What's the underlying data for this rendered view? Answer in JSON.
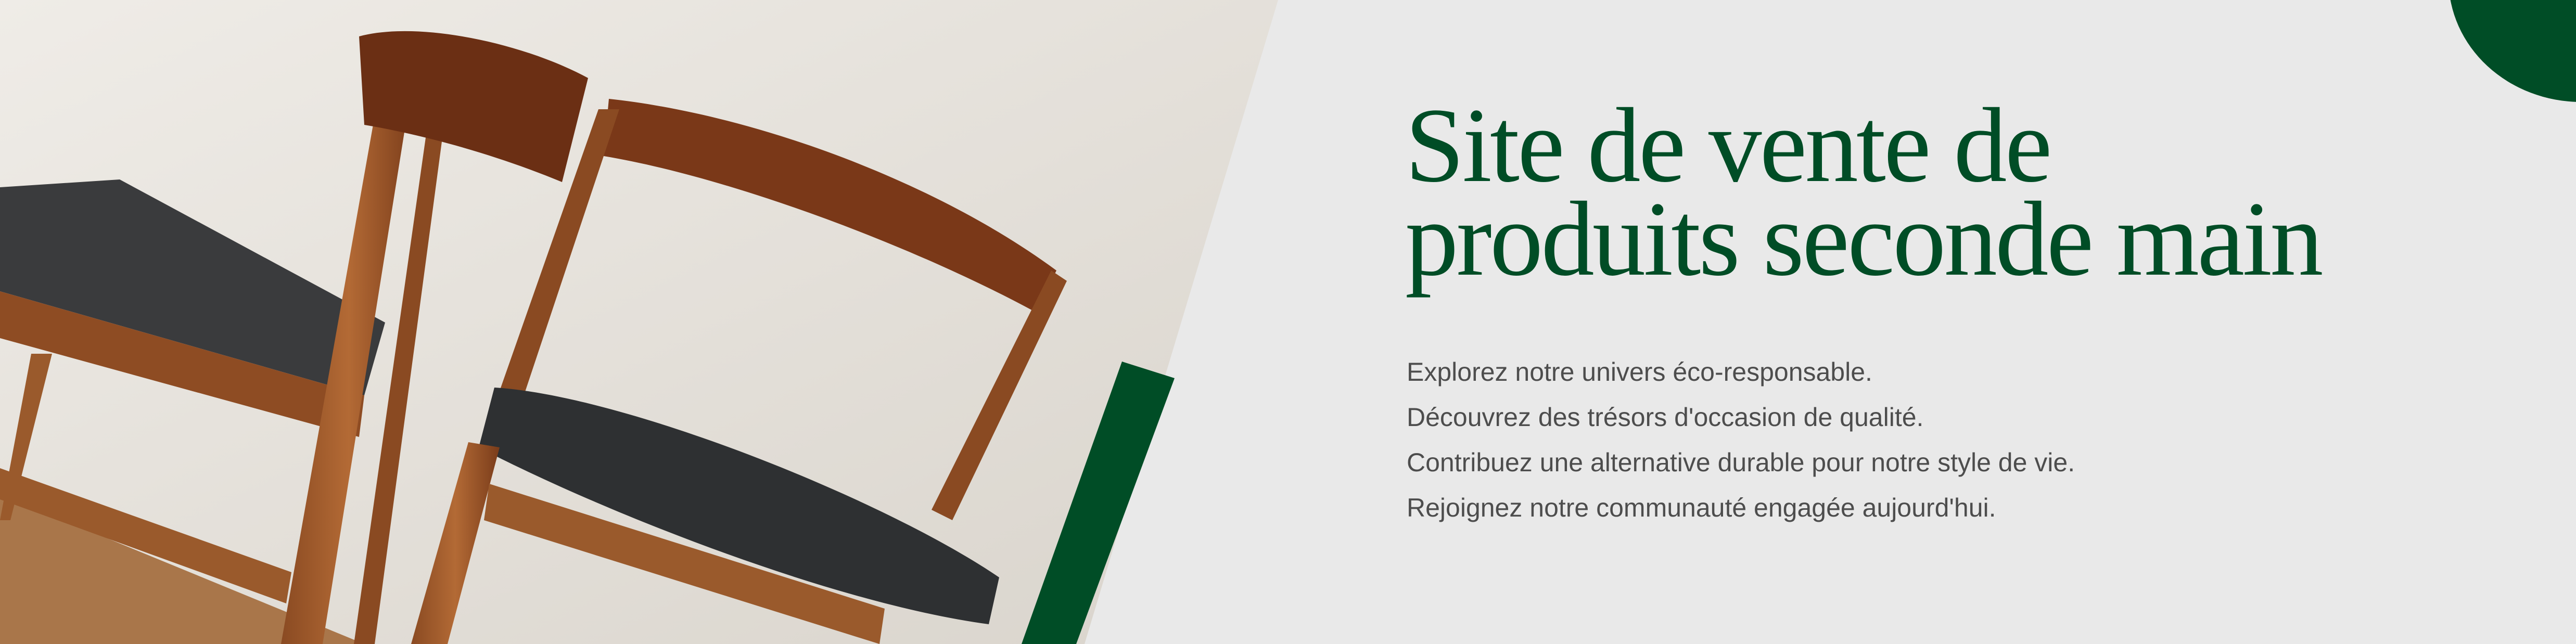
{
  "hero": {
    "title_line1": "Site de vente de",
    "title_line2": "produits seconde main",
    "lines": [
      "Explorez notre univers éco-responsable.",
      "Découvrez des trésors d'occasion de qualité.",
      "Contribuez une alternative durable pour notre style de vie.",
      "Rejoignez notre communauté engagée aujourd'hui."
    ]
  },
  "colors": {
    "accent": "#004d26",
    "background": "#e9e9e9",
    "text": "#4d4d4d"
  }
}
